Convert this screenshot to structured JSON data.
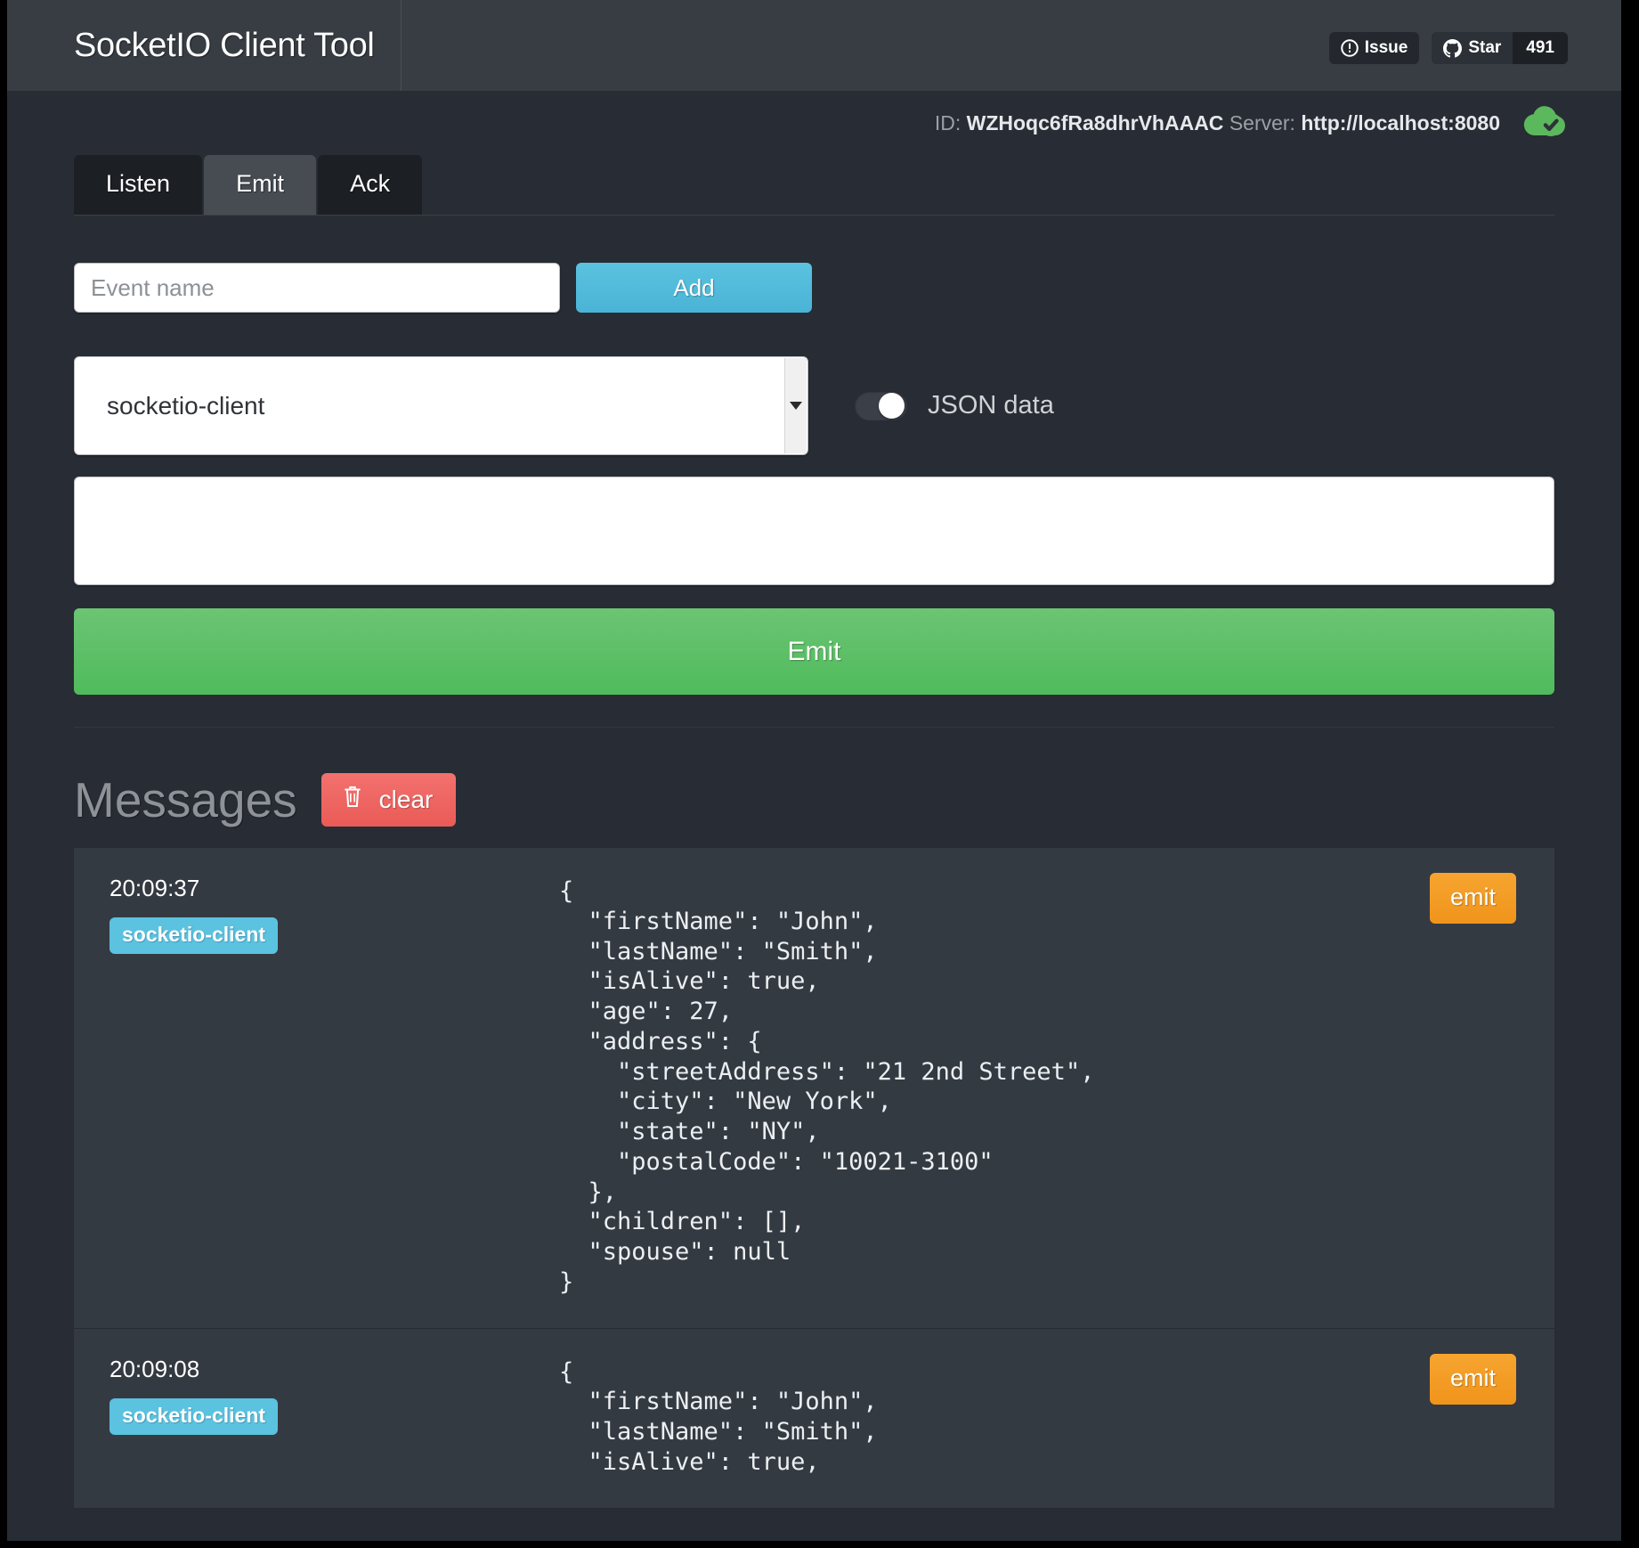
{
  "header": {
    "brand": "SocketIO Client Tool",
    "issue_label": "Issue",
    "star_label": "Star",
    "star_count": "491"
  },
  "connection": {
    "id_label": "ID:",
    "id_value": "WZHoqc6fRa8dhrVhAAAC",
    "server_label": "Server:",
    "server_value": "http://localhost:8080",
    "status_icon": "cloud-check-icon",
    "status_color": "#5cb85c"
  },
  "tabs": [
    {
      "label": "Listen",
      "active": false
    },
    {
      "label": "Emit",
      "active": true
    },
    {
      "label": "Ack",
      "active": false
    }
  ],
  "emit_form": {
    "event_name_placeholder": "Event name",
    "event_name_value": "",
    "add_label": "Add",
    "selected_event": "socketio-client",
    "event_options": [
      "socketio-client"
    ],
    "json_toggle_label": "JSON data",
    "json_toggle_on": true,
    "data_value": "",
    "emit_label": "Emit"
  },
  "messages_section": {
    "title": "Messages",
    "clear_label": "clear",
    "clear_icon": "trash-icon",
    "items": [
      {
        "time": "20:09:37",
        "event": "socketio-client",
        "emit_label": "emit",
        "payload": "{\n  \"firstName\": \"John\",\n  \"lastName\": \"Smith\",\n  \"isAlive\": true,\n  \"age\": 27,\n  \"address\": {\n    \"streetAddress\": \"21 2nd Street\",\n    \"city\": \"New York\",\n    \"state\": \"NY\",\n    \"postalCode\": \"10021-3100\"\n  },\n  \"children\": [],\n  \"spouse\": null\n}"
      },
      {
        "time": "20:09:08",
        "event": "socketio-client",
        "emit_label": "emit",
        "payload": "{\n  \"firstName\": \"John\",\n  \"lastName\": \"Smith\",\n  \"isAlive\": true,"
      }
    ]
  },
  "colors": {
    "page_bg": "#282c34",
    "navbar_bg": "#383d43",
    "accent_blue": "#5bc2e0",
    "accent_green": "#4fbb5c",
    "accent_red": "#ea5b57",
    "accent_orange": "#f0941b"
  }
}
